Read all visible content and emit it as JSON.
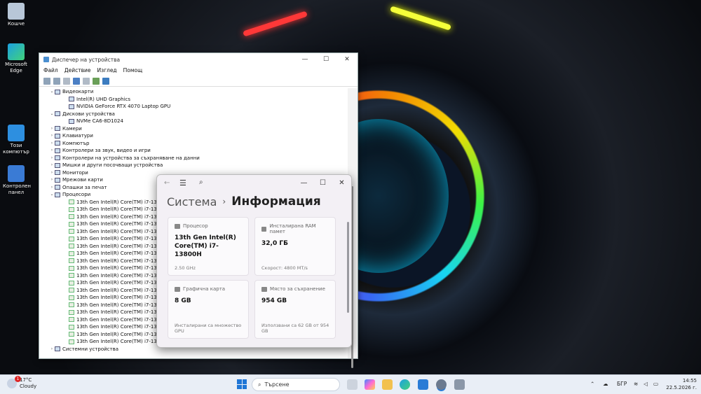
{
  "desktop": {
    "icons": [
      {
        "label": "Кошче"
      },
      {
        "label": "Microsoft Edge"
      },
      {
        "label": "Този компютър"
      },
      {
        "label": "Контролен панел"
      }
    ]
  },
  "device_manager": {
    "title": "Диспечер на устройства",
    "menu": [
      "Файл",
      "Действие",
      "Изглед",
      "Помощ"
    ],
    "tree": [
      {
        "level": 1,
        "expand": "⌄",
        "label": "Видеокарти"
      },
      {
        "level": 2,
        "expand": "",
        "label": "Intel(R) UHD Graphics"
      },
      {
        "level": 2,
        "expand": "",
        "label": "NVIDIA GeForce RTX 4070 Laptop GPU"
      },
      {
        "level": 1,
        "expand": "⌄",
        "label": "Дискови устройства"
      },
      {
        "level": 2,
        "expand": "",
        "label": "NVMe CA6-8D1024"
      },
      {
        "level": 1,
        "expand": "›",
        "label": "Камери"
      },
      {
        "level": 1,
        "expand": "›",
        "label": "Клавиатури"
      },
      {
        "level": 1,
        "expand": "›",
        "label": "Компютър"
      },
      {
        "level": 1,
        "expand": "›",
        "label": "Контролери за звук, видео и игри"
      },
      {
        "level": 1,
        "expand": "›",
        "label": "Контролери на устройства за съхраняване на данни"
      },
      {
        "level": 1,
        "expand": "›",
        "label": "Мишки и други посочващи устройства"
      },
      {
        "level": 1,
        "expand": "›",
        "label": "Монитори"
      },
      {
        "level": 1,
        "expand": "›",
        "label": "Мрежови карти"
      },
      {
        "level": 1,
        "expand": "›",
        "label": "Опашки за печат"
      },
      {
        "level": 1,
        "expand": "⌄",
        "label": "Процесори"
      },
      {
        "level": 2,
        "expand": "",
        "label": "13th Gen Intel(R) Core(TM) i7-13800H"
      },
      {
        "level": 2,
        "expand": "",
        "label": "13th Gen Intel(R) Core(TM) i7-13800H"
      },
      {
        "level": 2,
        "expand": "",
        "label": "13th Gen Intel(R) Core(TM) i7-13800H"
      },
      {
        "level": 2,
        "expand": "",
        "label": "13th Gen Intel(R) Core(TM) i7-13800H"
      },
      {
        "level": 2,
        "expand": "",
        "label": "13th Gen Intel(R) Core(TM) i7-13800H"
      },
      {
        "level": 2,
        "expand": "",
        "label": "13th Gen Intel(R) Core(TM) i7-13800H"
      },
      {
        "level": 2,
        "expand": "",
        "label": "13th Gen Intel(R) Core(TM) i7-13800H"
      },
      {
        "level": 2,
        "expand": "",
        "label": "13th Gen Intel(R) Core(TM) i7-13800H"
      },
      {
        "level": 2,
        "expand": "",
        "label": "13th Gen Intel(R) Core(TM) i7-13800H"
      },
      {
        "level": 2,
        "expand": "",
        "label": "13th Gen Intel(R) Core(TM) i7-13800H"
      },
      {
        "level": 2,
        "expand": "",
        "label": "13th Gen Intel(R) Core(TM) i7-13800H"
      },
      {
        "level": 2,
        "expand": "",
        "label": "13th Gen Intel(R) Core(TM) i7-13800H"
      },
      {
        "level": 2,
        "expand": "",
        "label": "13th Gen Intel(R) Core(TM) i7-13800H"
      },
      {
        "level": 2,
        "expand": "",
        "label": "13th Gen Intel(R) Core(TM) i7-13800H"
      },
      {
        "level": 2,
        "expand": "",
        "label": "13th Gen Intel(R) Core(TM) i7-13800H"
      },
      {
        "level": 2,
        "expand": "",
        "label": "13th Gen Intel(R) Core(TM) i7-13800H"
      },
      {
        "level": 2,
        "expand": "",
        "label": "13th Gen Intel(R) Core(TM) i7-13800H"
      },
      {
        "level": 2,
        "expand": "",
        "label": "13th Gen Intel(R) Core(TM) i7-13800H"
      },
      {
        "level": 2,
        "expand": "",
        "label": "13th Gen Intel(R) Core(TM) i7-13800H"
      },
      {
        "level": 2,
        "expand": "",
        "label": "13th Gen Intel(R) Core(TM) i7-13800H"
      },
      {
        "level": 1,
        "expand": "›",
        "label": "Системни устройства"
      }
    ]
  },
  "settings": {
    "breadcrumb_parent": "Система",
    "breadcrumb_current": "Информация",
    "cards": [
      {
        "label": "Процесор",
        "value": "13th Gen Intel(R) Core(TM) i7-13800H",
        "sub": "2.50 GHz"
      },
      {
        "label": "Инсталирана RAM памет",
        "value": "32,0 ГБ",
        "sub": "Скорост: 4800 MT/s"
      },
      {
        "label": "Графична карта",
        "value": "8 GB",
        "sub": "Инсталирани са множество GPU"
      },
      {
        "label": "Място за съхранение",
        "value": "954 GB",
        "sub": "Използвани са 62 GB от 954 GB"
      }
    ]
  },
  "taskbar": {
    "weather_temp": "17°C",
    "weather_desc": "Cloudy",
    "weather_badge": "1",
    "search_placeholder": "Търсене",
    "language": "БГР",
    "time": "14:55",
    "date": "22.5.2026 г."
  }
}
